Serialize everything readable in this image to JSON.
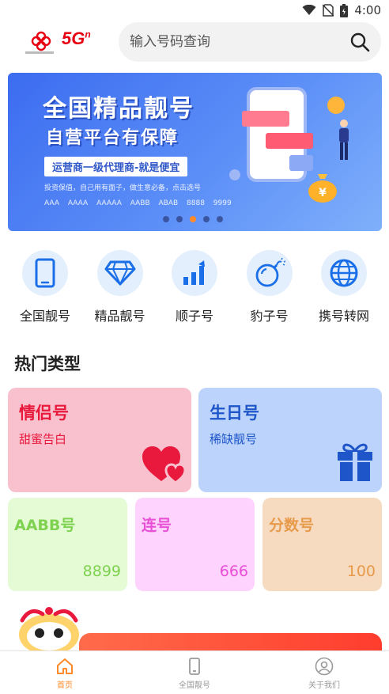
{
  "status_bar": {
    "time": "4:00"
  },
  "header": {
    "logo_5g": "5G",
    "logo_superscript": "n",
    "search_placeholder": "输入号码查询"
  },
  "banner": {
    "title": "全国精品靓号",
    "subtitle": "自营平台有保障",
    "tag": "运营商一级代理商-就是便宜",
    "line": "投资保值，自己用有面子，做生意必备，点击选号",
    "numbers": "AAA  AAAA  AAAAA  AABB  ABAB  8888  9999",
    "slide_count": 5,
    "active_slide": 3
  },
  "categories": [
    {
      "label": "全国靓号",
      "icon": "phone-icon"
    },
    {
      "label": "精品靓号",
      "icon": "diamond-icon"
    },
    {
      "label": "顺子号",
      "icon": "bar-chart-icon"
    },
    {
      "label": "豹子号",
      "icon": "bomb-icon"
    },
    {
      "label": "携号转网",
      "icon": "globe-icon"
    }
  ],
  "hot_section": {
    "title": "热门类型"
  },
  "hot_cards": {
    "lovers": {
      "title": "情侣号",
      "subtitle": "甜蜜告白",
      "icon": "hearts-icon",
      "color": "#e8193c"
    },
    "birthday": {
      "title": "生日号",
      "subtitle": "稀缺靓号",
      "icon": "gift-icon",
      "color": "#1e55c9"
    },
    "aabb": {
      "title": "AABB号",
      "value": "8899",
      "color": "#7fd24f"
    },
    "consecutive": {
      "title": "连号",
      "value": "666",
      "color": "#e84fd5"
    },
    "score": {
      "title": "分数号",
      "value": "100",
      "color": "#e89a4b"
    }
  },
  "tabs": [
    {
      "label": "首页",
      "icon": "home-icon",
      "active": true
    },
    {
      "label": "全国靓号",
      "icon": "phone-icon",
      "active": false
    },
    {
      "label": "关于我们",
      "icon": "user-icon",
      "active": false
    }
  ],
  "colors": {
    "accent": "#ff8a2a",
    "brand_red": "#e60012",
    "banner_blue": "#4a7bf2"
  }
}
